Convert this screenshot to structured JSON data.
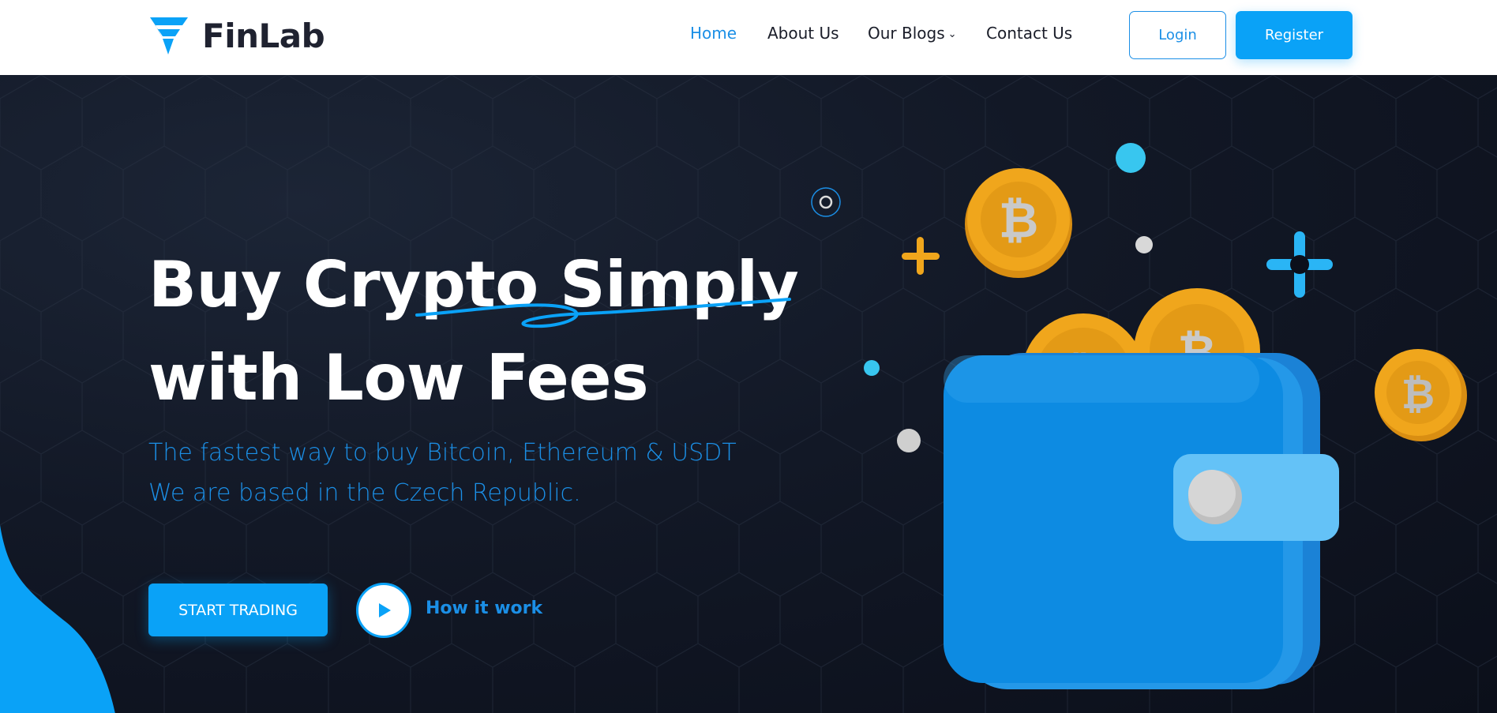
{
  "brand": {
    "name": "FinLab",
    "accent": "#0aa2f7",
    "link_color": "#1b8fe6",
    "dark_bg": "#0e1320",
    "coin_color": "#f0a61c"
  },
  "header": {
    "nav": [
      {
        "label": "Home",
        "active": true
      },
      {
        "label": "About Us",
        "active": false
      },
      {
        "label": "Our Blogs",
        "active": false,
        "dropdown": true
      },
      {
        "label": "Contact Us",
        "active": false
      }
    ],
    "login_label": "Login",
    "register_label": "Register"
  },
  "hero": {
    "headline_line1": "Buy Crypto Simply",
    "headline_line2": "with Low Fees",
    "sub_line1": "The fastest way to buy Bitcoin, Ethereum & USDT",
    "sub_line2": "We are based in the Czech Republic.",
    "cta_label": "START TRADING",
    "video_label": "How it work",
    "icons": [
      "play-icon",
      "wallet-illustration",
      "bitcoin-coin-icon",
      "sparkle-icon"
    ]
  }
}
